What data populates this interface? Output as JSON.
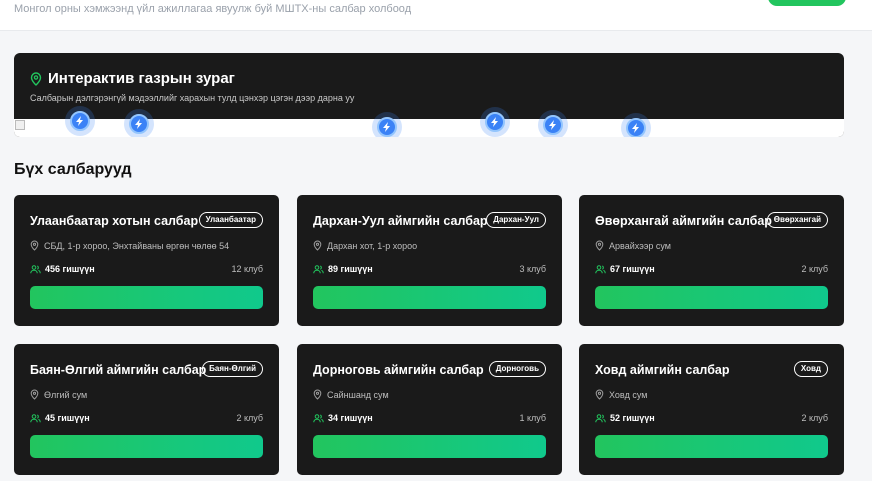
{
  "header": {
    "subtitle": "Монгол орны хэмжээнд үйл ажиллагаа явуулж буй МШТХ-ны салбар холбоод"
  },
  "map": {
    "title": "Интерактив газрын зураг",
    "subtitle": "Салбарын дэлгэрэнгүй мэдээллийг харахын тулд цэнхэр цэгэн дээр дарна уу",
    "marker_color": "#3b82f6"
  },
  "branches_section": {
    "title": "Бүх салбарууд"
  },
  "branches": [
    {
      "name": "Улаанбаатар хотын салбар",
      "badge": "Улаанбаатар",
      "address": "СБД, 1-р хороо, Энхтайваны өргөн чөлөө 54",
      "members": "456 гишүүн",
      "clubs": "12 клуб"
    },
    {
      "name": "Дархан-Уул аймгийн салбар",
      "badge": "Дархан-Уул",
      "address": "Дархан хот, 1-р хороо",
      "members": "89 гишүүн",
      "clubs": "3 клуб"
    },
    {
      "name": "Өвөрхангай аймгийн салбар",
      "badge": "Өвөрхангай",
      "address": "Арвайхээр сум",
      "members": "67 гишүүн",
      "clubs": "2 клуб"
    },
    {
      "name": "Баян-Өлгий аймгийн салбар",
      "badge": "Баян-Өлгий",
      "address": "Өлгий сум",
      "members": "45 гишүүн",
      "clubs": "2 клуб"
    },
    {
      "name": "Дорноговь аймгийн салбар",
      "badge": "Дорноговь",
      "address": "Сайншанд сум",
      "members": "34 гишүүн",
      "clubs": "1 клуб"
    },
    {
      "name": "Ховд аймгийн салбар",
      "badge": "Ховд",
      "address": "Ховд сум",
      "members": "52 гишүүн",
      "clubs": "2 клуб"
    }
  ],
  "colors": {
    "accent_green": "#22c55e",
    "card_bg": "#1a1a1a"
  }
}
